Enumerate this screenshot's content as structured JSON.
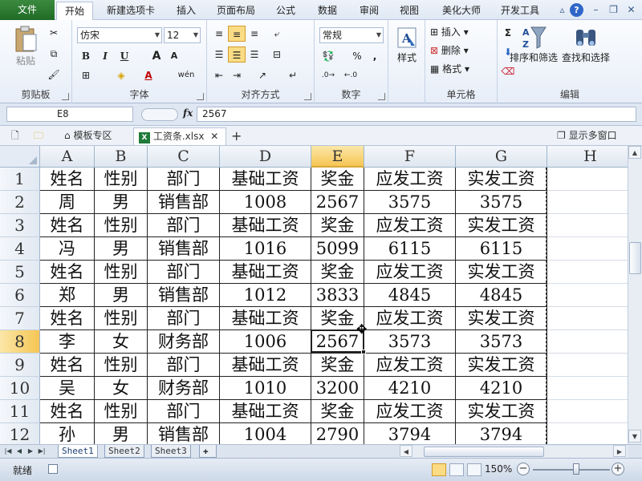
{
  "ribbon_tabs": {
    "file": "文件",
    "items": [
      "开始",
      "新建选项卡",
      "插入",
      "页面布局",
      "公式",
      "数据",
      "审阅",
      "视图",
      "美化大师",
      "开发工具"
    ],
    "active_index": 0
  },
  "clipboard": {
    "paste": "粘贴",
    "label": "剪贴板"
  },
  "font": {
    "name": "仿宋",
    "size": "12",
    "bold": "B",
    "italic": "I",
    "underline": "U",
    "grow": "A",
    "shrink": "A",
    "phonetic": "wén",
    "label": "字体"
  },
  "alignment": {
    "label": "对齐方式"
  },
  "number": {
    "format": "常规",
    "percent": "%",
    "comma": ",",
    "label": "数字"
  },
  "styles": {
    "label": "样式"
  },
  "cells": {
    "insert": "插入",
    "delete": "删除",
    "format": "格式",
    "label": "单元格"
  },
  "editing": {
    "sum": "Σ",
    "sort": "排序和筛选",
    "find": "查找和选择",
    "label": "编辑"
  },
  "formula_bar": {
    "name_box": "E8",
    "fx": "fx",
    "value": "2567"
  },
  "doc_tabs": {
    "template": "模板专区",
    "file": "工资条.xlsx",
    "add": "+",
    "show_window": "显示多窗口"
  },
  "grid": {
    "columns": [
      "A",
      "B",
      "C",
      "D",
      "E",
      "F",
      "G",
      "H"
    ],
    "rows": [
      [
        "姓名",
        "性别",
        "部门",
        "基础工资",
        "奖金",
        "应发工资",
        "实发工资"
      ],
      [
        "周",
        "男",
        "销售部",
        "1008",
        "2567",
        "3575",
        "3575"
      ],
      [
        "姓名",
        "性别",
        "部门",
        "基础工资",
        "奖金",
        "应发工资",
        "实发工资"
      ],
      [
        "冯",
        "男",
        "销售部",
        "1016",
        "5099",
        "6115",
        "6115"
      ],
      [
        "姓名",
        "性别",
        "部门",
        "基础工资",
        "奖金",
        "应发工资",
        "实发工资"
      ],
      [
        "郑",
        "男",
        "销售部",
        "1012",
        "3833",
        "4845",
        "4845"
      ],
      [
        "姓名",
        "性别",
        "部门",
        "基础工资",
        "奖金",
        "应发工资",
        "实发工资"
      ],
      [
        "李",
        "女",
        "财务部",
        "1006",
        "2567",
        "3573",
        "3573"
      ],
      [
        "姓名",
        "性别",
        "部门",
        "基础工资",
        "奖金",
        "应发工资",
        "实发工资"
      ],
      [
        "吴",
        "女",
        "财务部",
        "1010",
        "3200",
        "4210",
        "4210"
      ],
      [
        "姓名",
        "性别",
        "部门",
        "基础工资",
        "奖金",
        "应发工资",
        "实发工资"
      ],
      [
        "孙",
        "男",
        "销售部",
        "1004",
        "2790",
        "3794",
        "3794"
      ]
    ],
    "selected_column": "E",
    "selected_row": 8
  },
  "sheets": {
    "tabs": [
      "Sheet1",
      "Sheet2",
      "Sheet3"
    ],
    "active_index": 0
  },
  "status": {
    "ready": "就绪",
    "zoom": "150%",
    "minus": "−",
    "plus": "+",
    "zoom_level_percent": 150
  }
}
